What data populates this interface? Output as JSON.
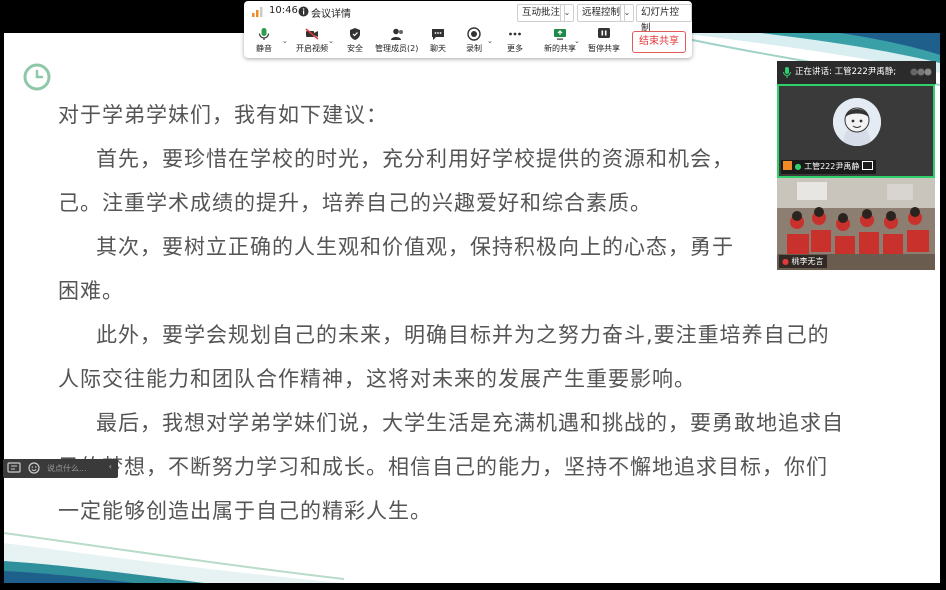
{
  "toolbar": {
    "time": "10:46",
    "meeting_details": "会议详情",
    "interactive_annotation": "互动批注",
    "remote_control": "远程控制",
    "slide_control": "幻灯片控制",
    "items": {
      "mute": "静音",
      "start_video": "开启视频",
      "security": "安全",
      "manage_members": "管理成员(2)",
      "chat": "聊天",
      "record": "录制",
      "more": "更多",
      "new_share": "新的共享",
      "pause_share": "暂停共享"
    },
    "end_share": "结束共享"
  },
  "content": {
    "lines": [
      "对于学弟学妹们，我有如下建议：",
      "首先，要珍惜在学校的时光，充分利用好学校提供的资源和机会，",
      "己。注重学术成绩的提升，培养自己的兴趣爱好和综合素质。",
      "其次，要树立正确的人生观和价值观，保持积极向上的心态，勇于",
      "困难。",
      "此外，要学会规划自己的未来，明确目标并为之努力奋斗,要注重培养自己的",
      "人际交往能力和团队合作精神，这将对未来的发展产生重要影响。",
      "最后，我想对学弟学妹们说，大学生活是充满机遇和挑战的，要勇敢地追求自",
      "己的梦想，不断努力学习和成长。相信自己的能力，坚持不懈地追求目标，你们",
      "一定能够创造出属于自己的精彩人生。"
    ]
  },
  "video_panel": {
    "speaking_label": "正在讲话:",
    "speaking_name": "工管222尹禹静;",
    "participant1_name": "工管222尹禹静",
    "participant2_name": "桃李无言"
  },
  "chat": {
    "placeholder": "说点什么..."
  },
  "colors": {
    "accent_green": "#2fd06a",
    "end_share_red": "#e03a3a",
    "wave_teal": "#1f7f8c",
    "text_gray": "#555555"
  }
}
